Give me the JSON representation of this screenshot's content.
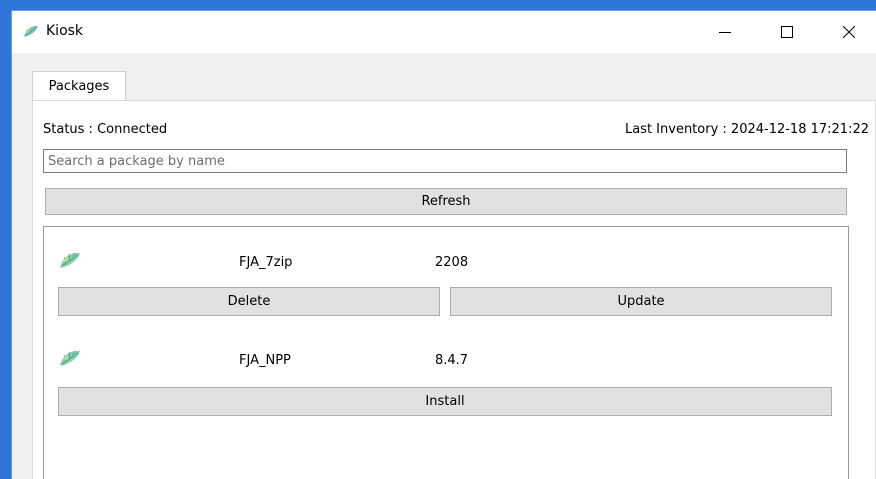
{
  "window": {
    "title": "Kiosk",
    "app_icon": "coral-leaf-icon",
    "controls": [
      "minimize-icon",
      "maximize-icon",
      "close-icon"
    ]
  },
  "tabs": [
    {
      "label": "Packages",
      "active": true
    }
  ],
  "status": {
    "text": "Status : Connected",
    "last_inventory": "Last Inventory : 2024-12-18 17:21:22"
  },
  "search": {
    "value": "",
    "placeholder": "Search a package by name"
  },
  "refresh_label": "Refresh",
  "packages": [
    {
      "name": "FJA_7zip",
      "version": "2208",
      "icon": "coral-leaf-icon",
      "actions": [
        "Delete",
        "Update"
      ]
    },
    {
      "name": "FJA_NPP",
      "version": "8.4.7",
      "icon": "coral-leaf-icon",
      "actions": [
        "Install"
      ]
    }
  ],
  "colors": {
    "desktop": "#2f77d6",
    "button_bg": "#e1e1e1",
    "button_border": "#adadad"
  }
}
